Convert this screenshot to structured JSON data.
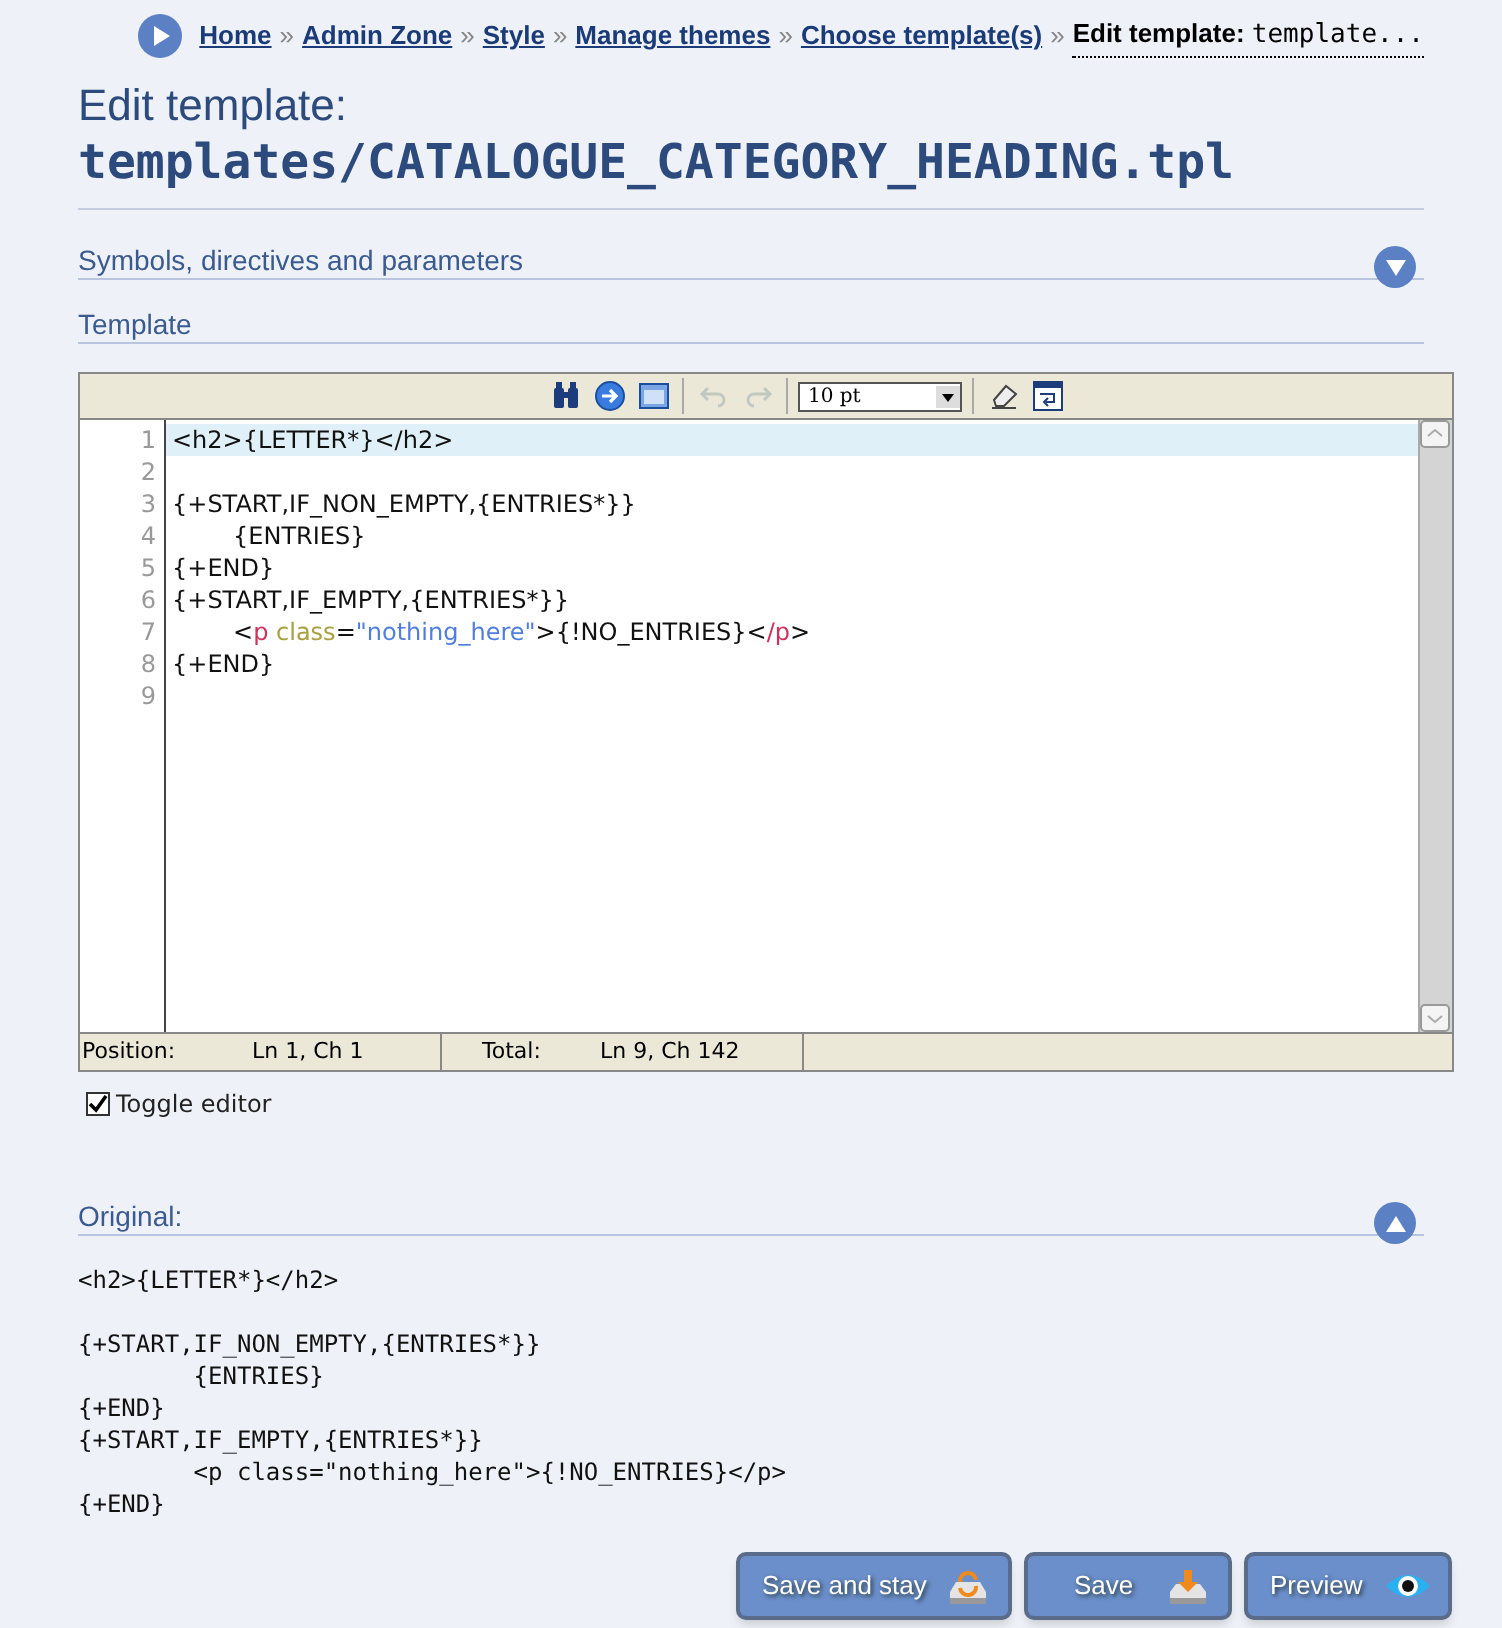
{
  "breadcrumb": {
    "links": [
      "Home",
      "Admin Zone",
      "Style",
      "Manage themes",
      "Choose template(s)"
    ],
    "separators": [
      "»",
      "»",
      "»",
      "»",
      "»"
    ],
    "current_label": "Edit template:",
    "current_value": "template..."
  },
  "title": {
    "line1": "Edit template:",
    "path": "templates/CATALOGUE_CATEGORY_HEADING.tpl"
  },
  "sections": [
    {
      "label": "Symbols, directives and parameters",
      "expanded": false
    },
    {
      "label": "Template"
    }
  ],
  "toolbar": [
    {
      "kind": "search",
      "disabled": false
    },
    {
      "kind": "goto",
      "disabled": false
    },
    {
      "kind": "fullscreen",
      "disabled": false
    },
    {
      "kind": "undo",
      "disabled": true
    },
    {
      "kind": "redo",
      "disabled": true
    },
    {
      "kind": "select",
      "value": "10 pt"
    },
    {
      "kind": "clear",
      "disabled": false
    },
    {
      "kind": "wrap",
      "disabled": false
    }
  ],
  "editor_lines": [
    {
      "number": "1",
      "selected": true,
      "tokens": [
        {
          "kind": "text",
          "text": "<h2>{LETTER*}</h2>"
        }
      ]
    },
    {
      "number": "2",
      "selected": false
    },
    {
      "number": "3",
      "selected": false,
      "tokens": [
        {
          "kind": "text",
          "text": "{+START,IF_NON_EMPTY,{ENTRIES*}}"
        }
      ]
    },
    {
      "number": "4",
      "selected": false,
      "tokens": [
        {
          "kind": "text",
          "text": "        {ENTRIES}"
        }
      ]
    },
    {
      "number": "5",
      "selected": false,
      "tokens": [
        {
          "kind": "text",
          "text": "{+END}"
        }
      ]
    },
    {
      "number": "6",
      "selected": false,
      "tokens": [
        {
          "kind": "text",
          "text": "{+START,IF_EMPTY,{ENTRIES*}}"
        }
      ]
    },
    {
      "number": "7",
      "selected": false,
      "tokens": [
        {
          "kind": "text",
          "text": "        <"
        },
        {
          "kind": "tag",
          "text": "p"
        },
        {
          "kind": "attr",
          "text": " class"
        },
        {
          "kind": "text",
          "text": "="
        },
        {
          "kind": "string",
          "text": "\"nothing_here\""
        },
        {
          "kind": "text",
          "text": ">{!NO_ENTRIES}<"
        },
        {
          "kind": "tag",
          "text": "/p"
        },
        {
          "kind": "text",
          "text": ">"
        }
      ]
    },
    {
      "number": "8",
      "selected": false,
      "tokens": [
        {
          "kind": "text",
          "text": "{+END}"
        }
      ]
    },
    {
      "number": "9",
      "selected": false
    }
  ],
  "status_bar": {
    "position_label": "Position:",
    "position_value": "Ln 1, Ch 1",
    "total_label": "Total:",
    "total_value": "Ln 9, Ch 142"
  },
  "toggle_editor": {
    "label": "Toggle editor",
    "checked": true
  },
  "original": {
    "label": "Original:",
    "expanded": true,
    "blocks": [
      [
        "<h2>{LETTER*}</h2>"
      ],
      [
        "{+START,IF_NON_EMPTY,{ENTRIES*}}",
        "        {ENTRIES}",
        "{+END}",
        "{+START,IF_EMPTY,{ENTRIES*}}",
        "        <p class=\"nothing_here\">{!NO_ENTRIES}</p>",
        "{+END}"
      ]
    ]
  },
  "buttons": [
    {
      "label": "Save and stay",
      "kind": "save-stay"
    },
    {
      "label": "Save",
      "kind": "save"
    },
    {
      "label": "Preview",
      "kind": "preview"
    }
  ]
}
